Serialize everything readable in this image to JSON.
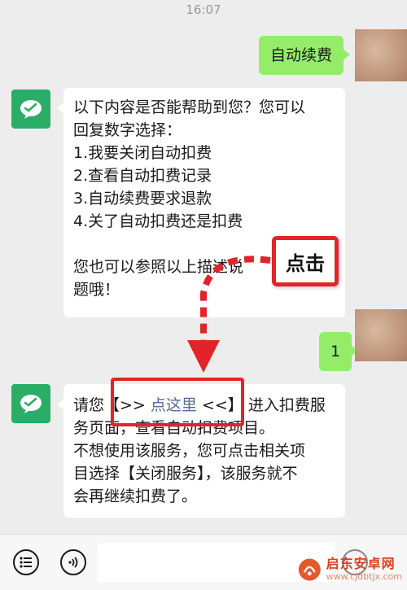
{
  "chat": {
    "timestamp": "16:07",
    "messages": [
      {
        "sender": "self",
        "text": "自动续费"
      },
      {
        "sender": "bot",
        "lines": [
          "以下内容是否能帮助到您？您可以",
          "回复数字选择：",
          "1.我要关闭自动扣费",
          "2.查看自动扣费记录",
          "3.自动续费要求退款",
          "4.关了自动扣费还是扣费",
          "",
          "您也可以参照以上描述说",
          "题哦！"
        ]
      },
      {
        "sender": "self",
        "text": "1"
      },
      {
        "sender": "bot",
        "prefix": "请您",
        "link_open": "【>> ",
        "link_text": "点这里",
        "link_close": " <<】",
        "suffix": "进入扣费服",
        "lines": [
          "务页面，查看自动扣费项目。",
          "不想使用该服务，您可点击相关项",
          "目选择【关闭服务】，该服务就不",
          "会再继续扣费了。"
        ]
      }
    ]
  },
  "annotation": {
    "callout_label": "点击",
    "color": "#e1242b"
  },
  "colors": {
    "self_bubble": "#95ec69",
    "bot_avatar": "#2aae67",
    "link": "#576b95"
  },
  "watermark": {
    "title": "启东安卓网",
    "url": "www.cjdbtjx.com"
  }
}
